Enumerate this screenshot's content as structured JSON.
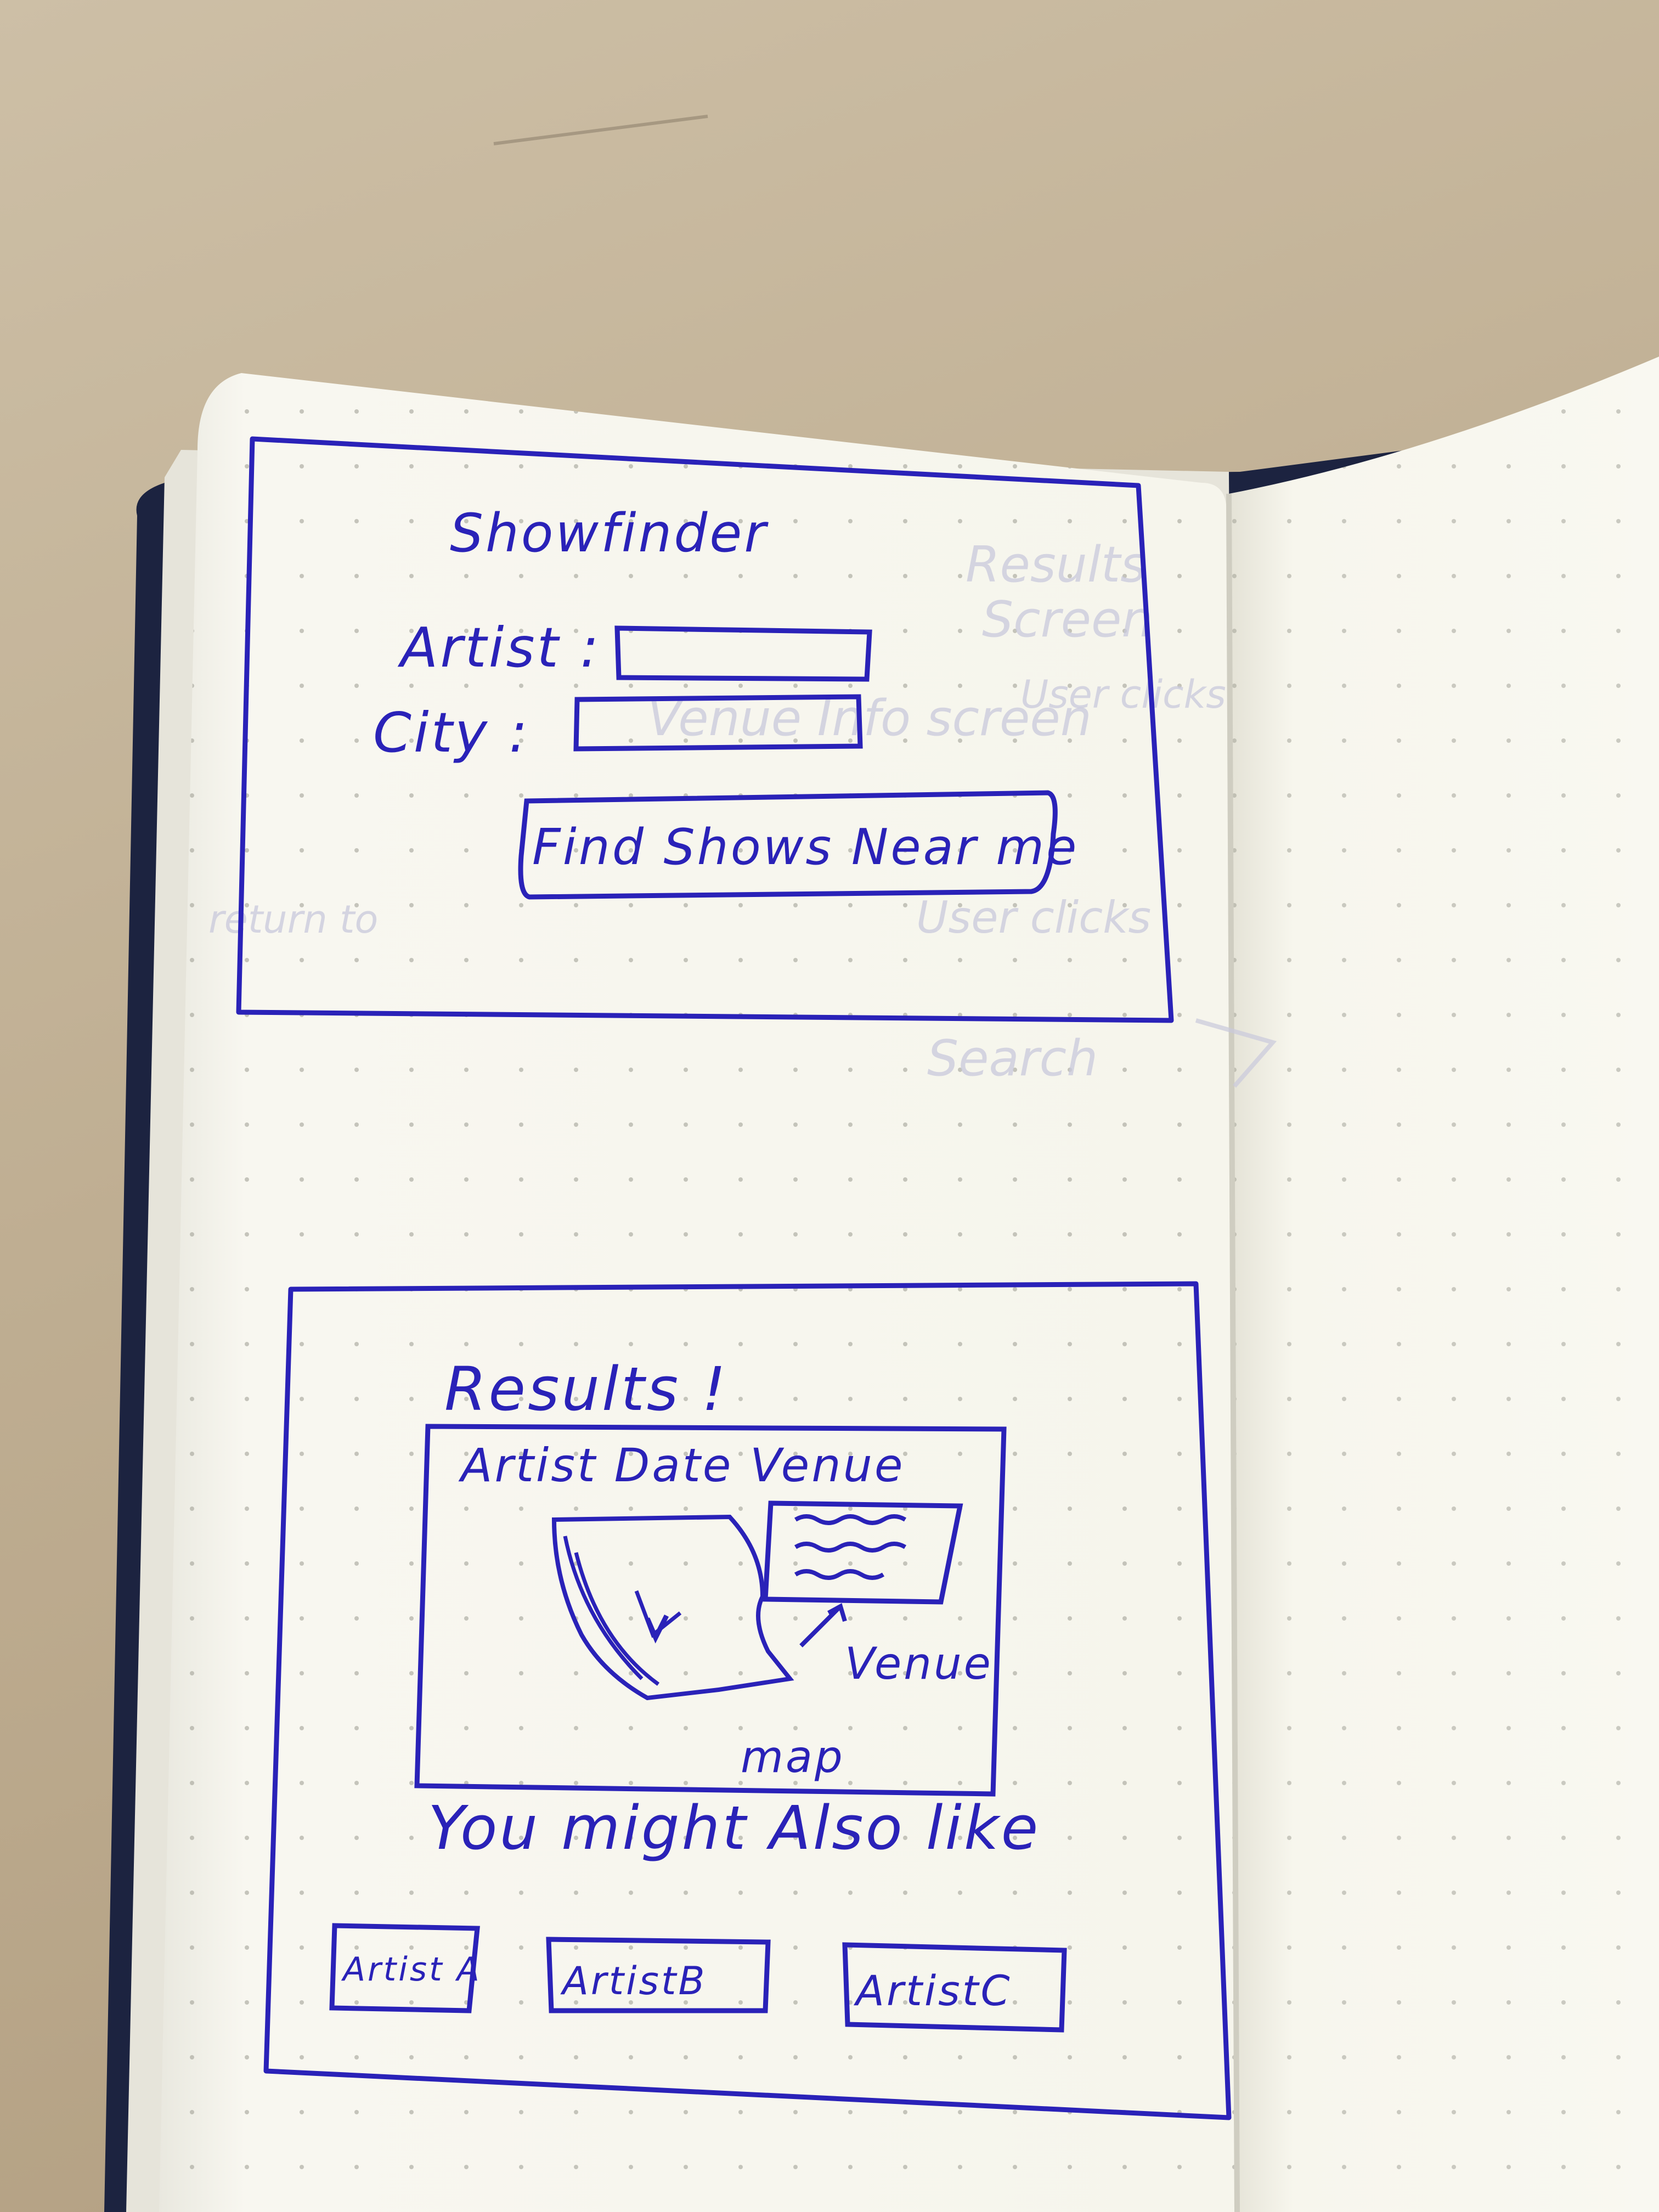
{
  "colors": {
    "ink": "#2a22b8",
    "paper": "#f7f6ef",
    "desk": "#c2b196",
    "cover": "#1c2340",
    "ghost_ink": "#c9c9dc"
  },
  "search_screen": {
    "title": "Showfinder",
    "artist_label": "Artist :",
    "city_label": "City :",
    "artist_value": "",
    "city_value": "",
    "find_button_label": "Find Shows Near me"
  },
  "results_screen": {
    "title": "Results !",
    "result_card": {
      "header": "Artist Date Venue",
      "venue_label": "Venue",
      "map_label": "map"
    },
    "recommendations_label": "You might Also like",
    "recommended_artists": [
      "Artist A",
      "ArtistB",
      "ArtistC"
    ]
  },
  "bleed_through": {
    "notes": [
      "Results",
      "Screen",
      "User clicks",
      "Venue Info screen",
      "User clicks",
      "return to",
      "Search"
    ]
  }
}
